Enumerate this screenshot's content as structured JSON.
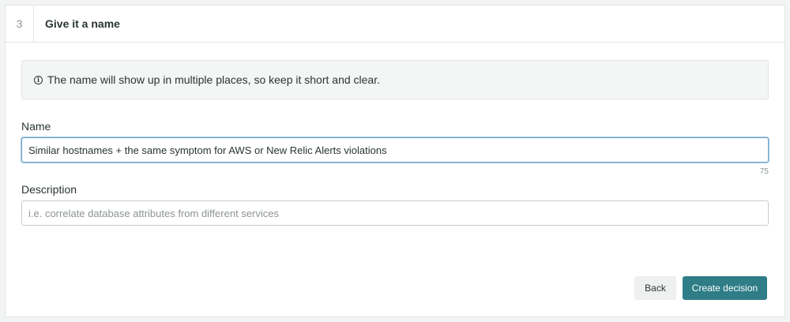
{
  "step": {
    "number": "3",
    "title": "Give it a name"
  },
  "info": {
    "icon": "info-icon",
    "glyph": "i",
    "message": "The name will show up in multiple places, so keep it short and clear."
  },
  "name_field": {
    "label": "Name",
    "value": "Similar hostnames + the same symptom for AWS or New Relic Alerts violations",
    "char_count": "75"
  },
  "description_field": {
    "label": "Description",
    "value": "",
    "placeholder": "i.e. correlate database attributes from different services"
  },
  "actions": {
    "back_label": "Back",
    "create_label": "Create decision"
  },
  "colors": {
    "primary": "#2e7d87",
    "focus_border": "#6aa3cc"
  }
}
